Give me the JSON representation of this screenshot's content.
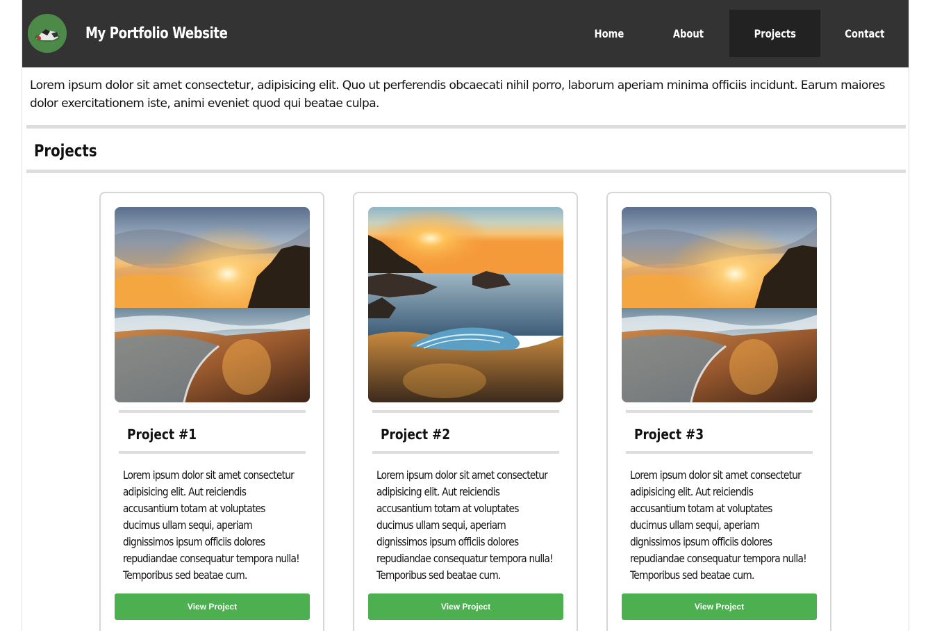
{
  "header": {
    "title": "My Portfolio Website",
    "nav": [
      {
        "label": "Home",
        "active": false
      },
      {
        "label": "About",
        "active": false
      },
      {
        "label": "Projects",
        "active": true
      },
      {
        "label": "Contact",
        "active": false
      }
    ],
    "background_color": "#333333",
    "active_nav_color": "#222222"
  },
  "intro": {
    "text": "Lorem ipsum dolor sit amet consectetur, adipisicing elit. Quo ut perferendis obcaecati nihil porro, laborum aperiam minima officiis incidunt. Earum maiores dolor exercitationem iste, animi eveniet quod qui beatae culpa."
  },
  "projects": {
    "heading": "Projects",
    "items": [
      {
        "title": "Project #1",
        "description": "Lorem ipsum dolor sit amet consectetur adipisicing elit. Aut reiciendis accusantium totam at voluptates ducimus ullam sequi, aperiam dignissimos ipsum officiis dolores repudiandae consequatur tempora nulla! Temporibus sed beatae cum.",
        "button_label": "View Project",
        "image": "beach-sunset-cliff"
      },
      {
        "title": "Project #2",
        "description": "Lorem ipsum dolor sit amet consectetur adipisicing elit. Aut reiciendis accusantium totam at voluptates ducimus ullam sequi, aperiam dignissimos ipsum officiis dolores repudiandae consequatur tempora nulla! Temporibus sed beatae cum.",
        "button_label": "View Project",
        "image": "beach-sunset-rocks"
      },
      {
        "title": "Project #3",
        "description": "Lorem ipsum dolor sit amet consectetur adipisicing elit. Aut reiciendis accusantium totam at voluptates ducimus ullam sequi, aperiam dignissimos ipsum officiis dolores repudiandae consequatur tempora nulla! Temporibus sed beatae cum.",
        "button_label": "View Project",
        "image": "beach-sunset-cliff"
      }
    ]
  },
  "colors": {
    "button": "#4caf50",
    "divider": "#dddddd"
  }
}
